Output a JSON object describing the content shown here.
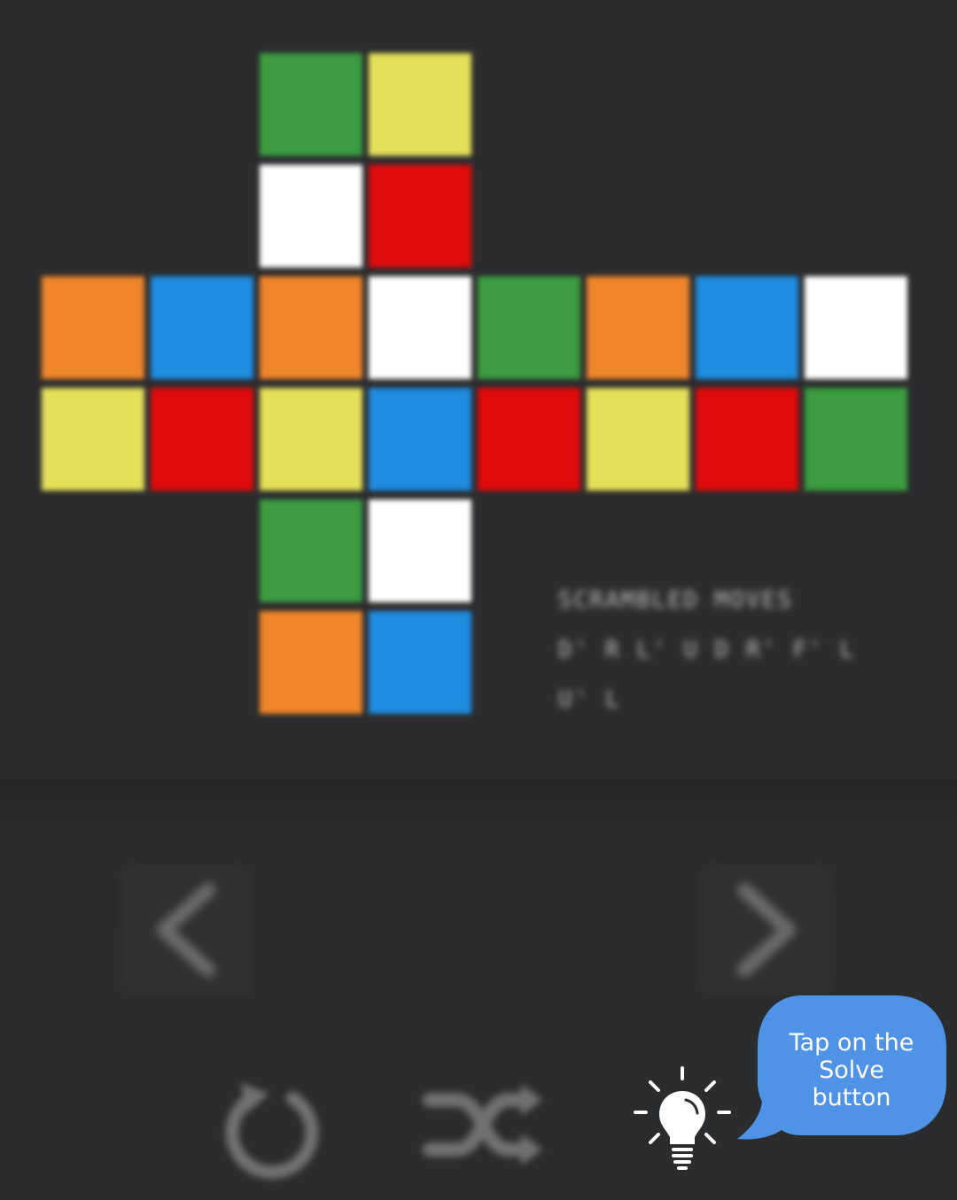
{
  "palette": {
    "green": "#3b9c40",
    "yellow": "#e6e05a",
    "white": "#ffffff",
    "red": "#e00b0c",
    "orange": "#ef862c",
    "blue": "#1f8ce0"
  },
  "cube_net": {
    "rows": [
      [
        "",
        "",
        "green",
        "yellow",
        "",
        "",
        "",
        ""
      ],
      [
        "",
        "",
        "white",
        "red",
        "",
        "",
        "",
        ""
      ],
      [
        "orange",
        "blue",
        "orange",
        "white",
        "green",
        "orange",
        "blue",
        "white"
      ],
      [
        "yellow",
        "red",
        "yellow",
        "blue",
        "red",
        "yellow",
        "red",
        "green"
      ],
      [
        "",
        "",
        "green",
        "white",
        "",
        "",
        "",
        ""
      ],
      [
        "",
        "",
        "orange",
        "blue",
        "",
        "",
        "",
        ""
      ]
    ]
  },
  "scramble": {
    "line1": "SCRAMBLED MOVES",
    "line2": "D' R L' U D R' F' L U' L"
  },
  "controls": {
    "prev_icon": "chevron-left-icon",
    "next_icon": "chevron-right-icon",
    "reset_icon": "reset-icon",
    "shuffle_icon": "shuffle-icon",
    "solve_icon": "lightbulb-icon"
  },
  "tooltip": {
    "line1": "Tap on the",
    "line2": "Solve",
    "line3": "button",
    "color": "#4f93e6"
  }
}
